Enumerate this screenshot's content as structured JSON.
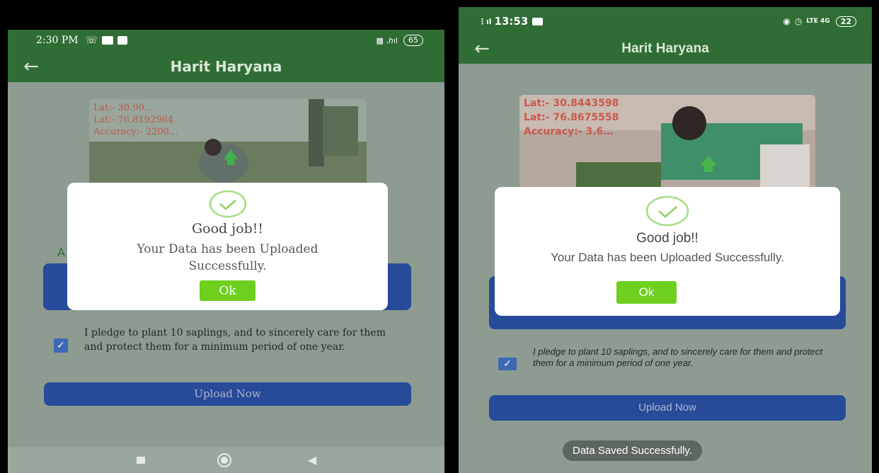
{
  "left": {
    "status_time": "2:30 PM",
    "battery": "65",
    "app_title": "Harit Haryana",
    "geo": {
      "lat1": "Lat:- 30.90…",
      "lat2": "Lat:- 76.8192964",
      "accuracy": "Accuracy:- 2200…"
    },
    "dialog": {
      "title": "Good job!!",
      "message": "Your Data has been Uploaded Successfully.",
      "ok": "Ok"
    },
    "pledge": "I pledge to plant 10 saplings, and to sincerely care for them and protect them for a minimum period of one year.",
    "upload_label": "Upload Now",
    "partial_label": "A"
  },
  "right": {
    "status_time": "13:53",
    "battery": "22",
    "app_title": "Harit Haryana",
    "geo": {
      "lat1": "Lat:- 30.8443598",
      "lat2": "Lat:- 76.8675558",
      "accuracy": "Accuracy:- 3.6…"
    },
    "dialog": {
      "title": "Good job!!",
      "message": "Your Data has been Uploaded Successfully.",
      "ok": "Ok"
    },
    "pledge": "I pledge to plant 10 saplings, and to sincerely care for them and protect them for a minimum period of one year.",
    "upload_label": "Upload Now",
    "toast": "Data Saved Successfully."
  },
  "colors": {
    "appbar": "#306d35",
    "dialog_ok": "#6ecf1f",
    "button_blue": "#274a99",
    "overlay_text": "#b85a4f"
  }
}
